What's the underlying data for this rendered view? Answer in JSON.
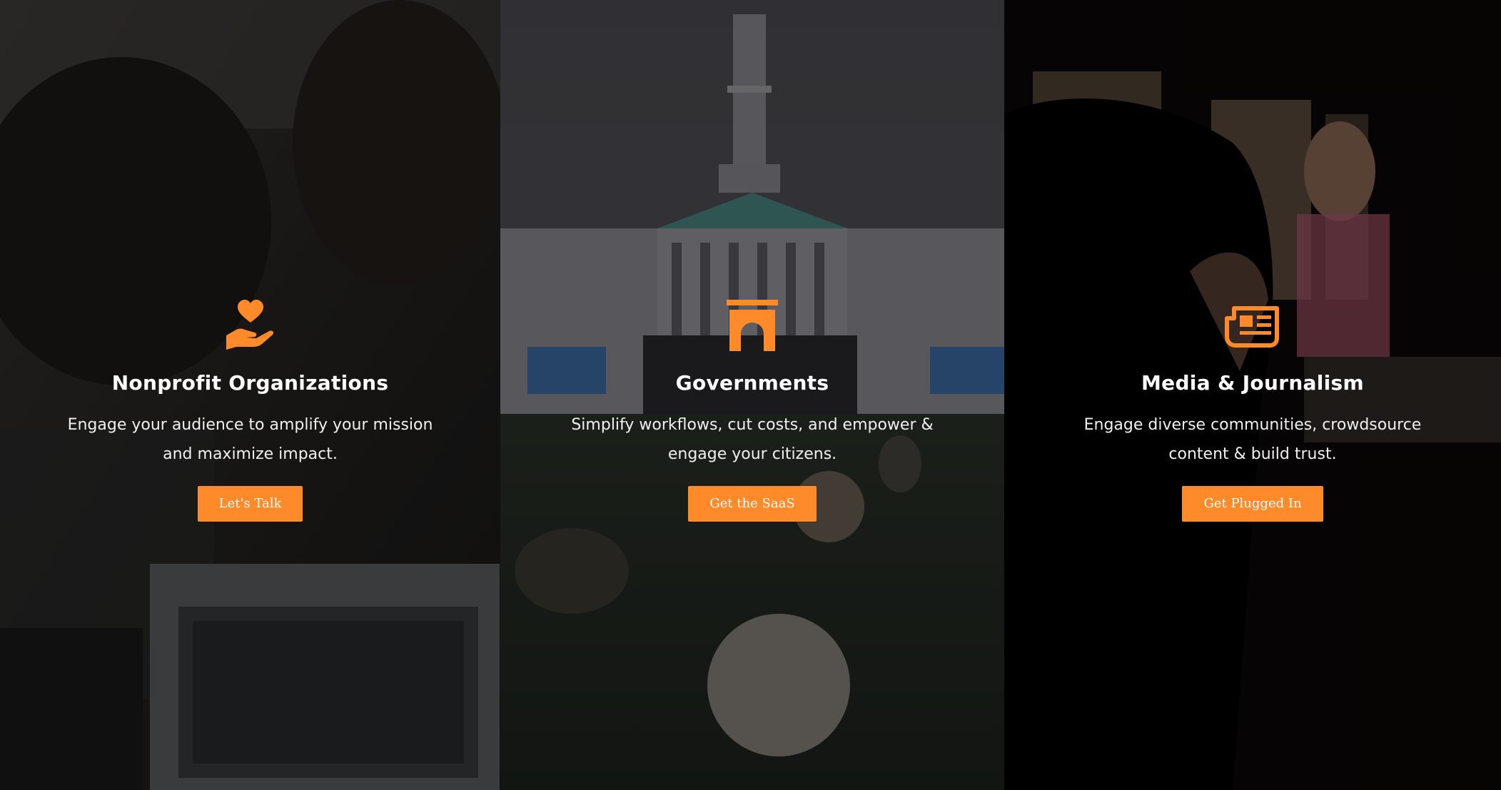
{
  "theme": {
    "accent": "#ff8a2a"
  },
  "panels": [
    {
      "title": "Nonprofit Organizations",
      "description": "Engage your audience to amplify your mission and maximize impact.",
      "button_label": "Let's Talk",
      "icon": "hand-heart-icon"
    },
    {
      "title": "Governments",
      "description": "Simplify workflows, cut costs, and empower & engage your citizens.",
      "button_label": "Get the SaaS",
      "icon": "government-arch-icon"
    },
    {
      "title": "Media & Journalism",
      "description": "Engage diverse communities, crowdsource content & build trust.",
      "button_label": "Get Plugged In",
      "icon": "newspaper-icon"
    }
  ]
}
